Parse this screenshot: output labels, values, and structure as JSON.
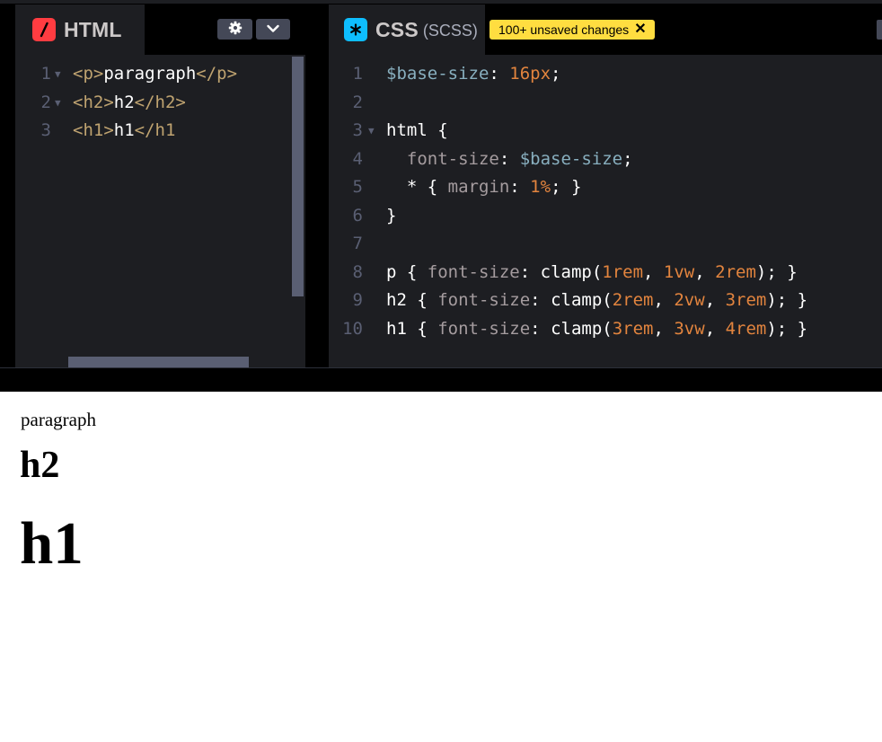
{
  "html_panel": {
    "title": "HTML",
    "icon": "html-slash-icon",
    "lines": [
      {
        "n": "1",
        "fold": true,
        "tokens": [
          [
            "tag",
            "<p>"
          ],
          [
            "txt",
            "paragraph"
          ],
          [
            "tag",
            "</p>"
          ]
        ]
      },
      {
        "n": "2",
        "fold": true,
        "tokens": [
          [
            "tag",
            "<h2>"
          ],
          [
            "txt",
            "h2"
          ],
          [
            "tag",
            "</h2>"
          ]
        ]
      },
      {
        "n": "3",
        "fold": false,
        "tokens": [
          [
            "tag",
            "<h1>"
          ],
          [
            "txt",
            "h1"
          ],
          [
            "tag",
            "</h1"
          ]
        ]
      }
    ]
  },
  "css_panel": {
    "title": "CSS",
    "subtitle": "(SCSS)",
    "icon": "css-asterisk-icon",
    "unsaved_label": "100+ unsaved changes",
    "lines": [
      {
        "n": "1",
        "fold": false,
        "tokens": [
          [
            "var",
            "$base-size"
          ],
          [
            "pun",
            ": "
          ],
          [
            "num",
            "16px"
          ],
          [
            "pun",
            ";"
          ]
        ]
      },
      {
        "n": "2",
        "fold": false,
        "tokens": []
      },
      {
        "n": "3",
        "fold": true,
        "tokens": [
          [
            "sel",
            "html"
          ],
          [
            "pun",
            " {"
          ]
        ]
      },
      {
        "n": "4",
        "fold": false,
        "tokens": [
          [
            "pun",
            "  "
          ],
          [
            "prop",
            "font-size"
          ],
          [
            "pun",
            ": "
          ],
          [
            "var",
            "$base-size"
          ],
          [
            "pun",
            ";"
          ]
        ]
      },
      {
        "n": "5",
        "fold": false,
        "tokens": [
          [
            "pun",
            "  * { "
          ],
          [
            "prop",
            "margin"
          ],
          [
            "pun",
            ": "
          ],
          [
            "num",
            "1%"
          ],
          [
            "pun",
            "; }"
          ]
        ]
      },
      {
        "n": "6",
        "fold": false,
        "tokens": [
          [
            "pun",
            "}"
          ]
        ]
      },
      {
        "n": "7",
        "fold": false,
        "tokens": []
      },
      {
        "n": "8",
        "fold": false,
        "tokens": [
          [
            "sel",
            "p"
          ],
          [
            "pun",
            " { "
          ],
          [
            "prop",
            "font-size"
          ],
          [
            "pun",
            ": "
          ],
          [
            "fn",
            "clamp("
          ],
          [
            "num",
            "1rem"
          ],
          [
            "pun",
            ", "
          ],
          [
            "num",
            "1vw"
          ],
          [
            "pun",
            ", "
          ],
          [
            "num",
            "2rem"
          ],
          [
            "pun",
            "); }"
          ]
        ]
      },
      {
        "n": "9",
        "fold": false,
        "tokens": [
          [
            "sel",
            "h2"
          ],
          [
            "pun",
            " { "
          ],
          [
            "prop",
            "font-size"
          ],
          [
            "pun",
            ": "
          ],
          [
            "fn",
            "clamp("
          ],
          [
            "num",
            "2rem"
          ],
          [
            "pun",
            ", "
          ],
          [
            "num",
            "2vw"
          ],
          [
            "pun",
            ", "
          ],
          [
            "num",
            "3rem"
          ],
          [
            "pun",
            "); }"
          ]
        ]
      },
      {
        "n": "10",
        "fold": false,
        "tokens": [
          [
            "sel",
            "h1"
          ],
          [
            "pun",
            " { "
          ],
          [
            "prop",
            "font-size"
          ],
          [
            "pun",
            ": "
          ],
          [
            "fn",
            "clamp("
          ],
          [
            "num",
            "3rem"
          ],
          [
            "pun",
            ", "
          ],
          [
            "num",
            "3vw"
          ],
          [
            "pun",
            ", "
          ],
          [
            "num",
            "4rem"
          ],
          [
            "pun",
            "); }"
          ]
        ]
      }
    ]
  },
  "preview": {
    "p": "paragraph",
    "h2": "h2",
    "h1": "h1"
  },
  "colors": {
    "html_accent": "#ff3c41",
    "css_accent": "#0ebeff",
    "badge": "#ffdd40"
  }
}
